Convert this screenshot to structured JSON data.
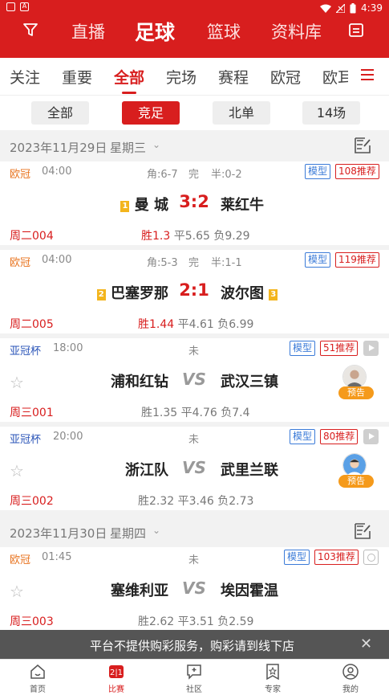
{
  "status_bar": {
    "time": "4:39"
  },
  "top_nav": {
    "tabs": [
      "直播",
      "足球",
      "篮球",
      "资料库"
    ],
    "active": "足球"
  },
  "sub_tabs": [
    "关注",
    "重要",
    "全部",
    "完场",
    "赛程",
    "欧冠",
    "欧耳"
  ],
  "sub_tab_active": "全部",
  "segments": [
    "全部",
    "竞足",
    "北单",
    "14场"
  ],
  "segment_active": "竞足",
  "groups": [
    {
      "date": "2023年11月29日",
      "weekday": "星期三"
    },
    {
      "date": "2023年11月30日",
      "weekday": "星期四"
    }
  ],
  "matches": [
    {
      "league": "欧冠",
      "league_color": "#e8731e",
      "time": "04:00",
      "corner": "角:6-7",
      "state": "完",
      "half": "半:0-2",
      "model": "模型",
      "rec": "108推荐",
      "home_rank": "1",
      "home": "曼 城",
      "score": "3:2",
      "away": "莱红牛",
      "away_rank": "",
      "code": "周二004",
      "odds_win": "胜1.3",
      "odds_draw": "平5.65",
      "odds_lose": "负9.29"
    },
    {
      "league": "欧冠",
      "league_color": "#e8731e",
      "time": "04:00",
      "corner": "角:5-3",
      "state": "完",
      "half": "半:1-1",
      "model": "模型",
      "rec": "119推荐",
      "home_rank": "2",
      "home": "巴塞罗那",
      "score": "2:1",
      "away": "波尔图",
      "away_rank": "3",
      "code": "周二005",
      "odds_win": "胜1.44",
      "odds_draw": "平4.61",
      "odds_lose": "负6.99"
    },
    {
      "league": "亚冠杯",
      "league_color": "#2b55b8",
      "time": "18:00",
      "state": "未",
      "model": "模型",
      "rec": "51推荐",
      "home": "浦和红钻",
      "vs": "VS",
      "away": "武汉三镇",
      "badge": "预告",
      "code": "周三001",
      "odds_win": "胜1.35",
      "odds_draw": "平4.76",
      "odds_lose": "负7.4"
    },
    {
      "league": "亚冠杯",
      "league_color": "#2b55b8",
      "time": "20:00",
      "state": "未",
      "model": "模型",
      "rec": "80推荐",
      "home": "浙江队",
      "vs": "VS",
      "away": "武里兰联",
      "badge": "预告",
      "code": "周三002",
      "odds_win": "胜2.32",
      "odds_draw": "平3.46",
      "odds_lose": "负2.73"
    },
    {
      "league": "欧冠",
      "league_color": "#e8731e",
      "time": "01:45",
      "state": "未",
      "model": "模型",
      "rec": "103推荐",
      "home": "塞维利亚",
      "vs": "VS",
      "away": "埃因霍温",
      "code": "周三003",
      "odds_win": "胜2.62",
      "odds_draw": "平3.51",
      "odds_lose": "负2.59"
    }
  ],
  "notice": "平台不提供购彩服务，购彩请到线下店",
  "bottom_tabs": [
    {
      "label": "首页",
      "icon": "home-icon"
    },
    {
      "label": "比赛",
      "icon": "match-icon"
    },
    {
      "label": "社区",
      "icon": "community-icon"
    },
    {
      "label": "专家",
      "icon": "expert-icon"
    },
    {
      "label": "我的",
      "icon": "profile-icon"
    }
  ],
  "bottom_tab_active": "比赛",
  "colors": {
    "brand": "#d81e1e",
    "model_blue": "#3b7bd8",
    "badge_orange": "#f59a1b"
  }
}
